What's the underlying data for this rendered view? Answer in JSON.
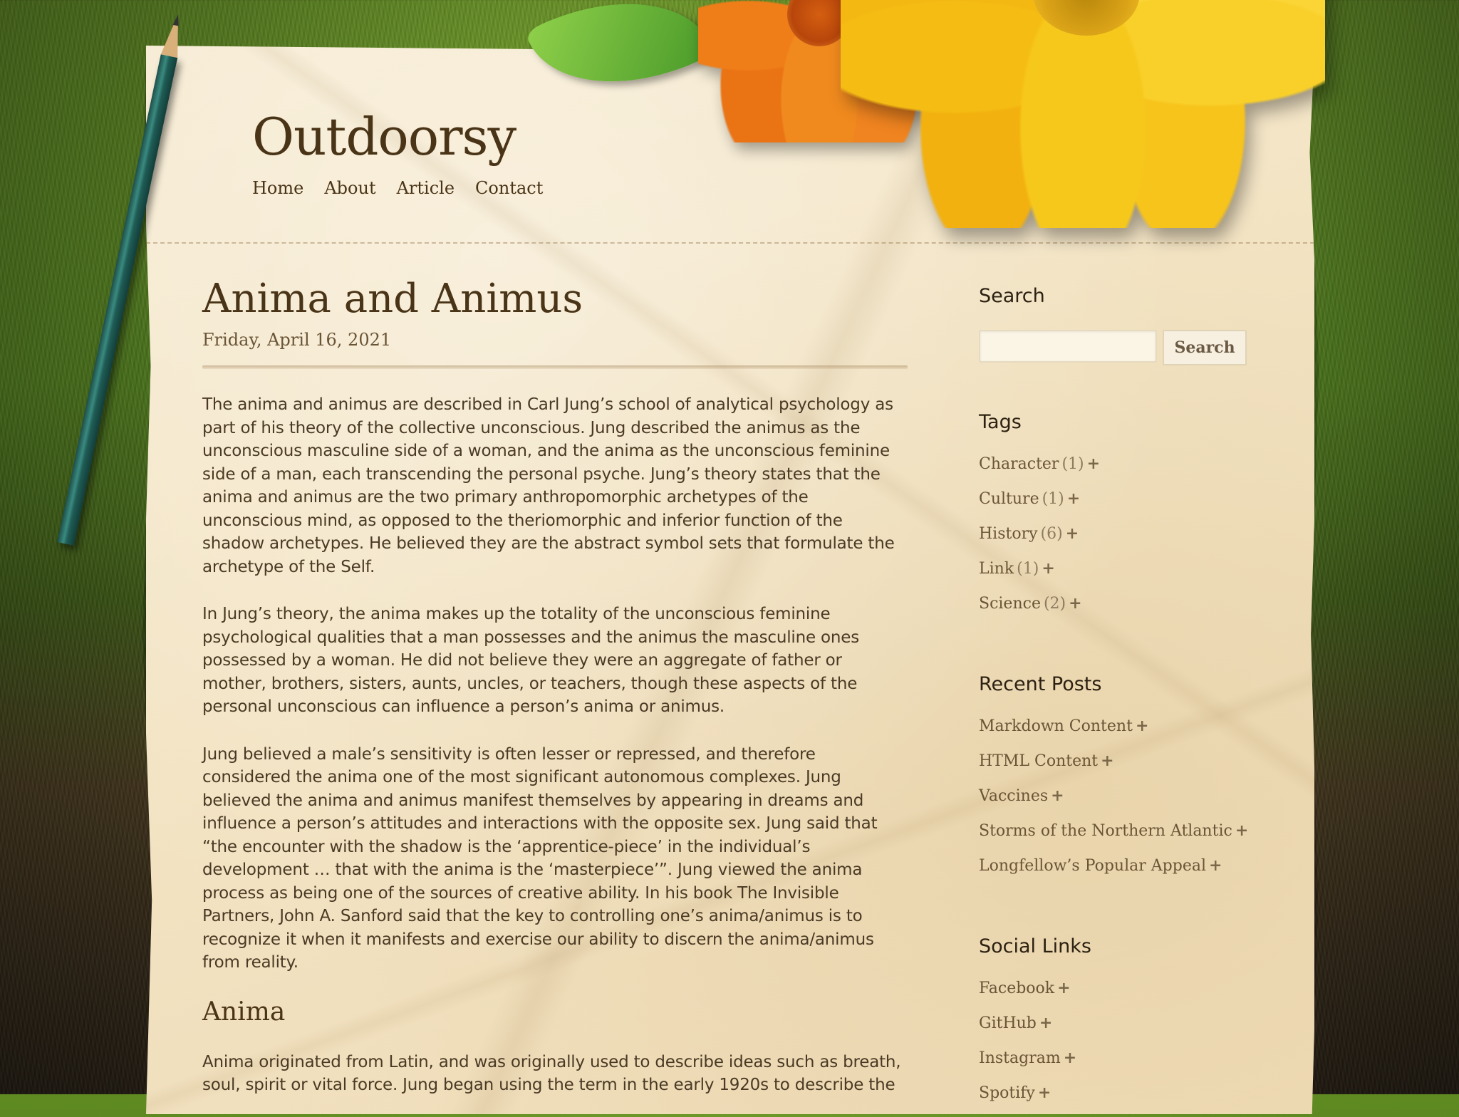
{
  "site": {
    "title": "Outdoorsy",
    "nav": [
      "Home",
      "About",
      "Article",
      "Contact"
    ]
  },
  "post": {
    "title": "Anima and Animus",
    "date": "Friday, April 16, 2021",
    "paragraphs": [
      "The anima and animus are described in Carl Jung’s school of analytical psychology as part of his theory of the collective unconscious. Jung described the animus as the unconscious masculine side of a woman, and the anima as the unconscious feminine side of a man, each transcending the personal psyche. Jung’s theory states that the anima and animus are the two primary anthropomorphic archetypes of the unconscious mind, as opposed to the theriomorphic and inferior function of the shadow archetypes. He believed they are the abstract symbol sets that formulate the archetype of the Self.",
      "In Jung’s theory, the anima makes up the totality of the unconscious feminine psychological qualities that a man possesses and the animus the masculine ones possessed by a woman. He did not believe they were an aggregate of father or mother, brothers, sisters, aunts, uncles, or teachers, though these aspects of the personal unconscious can influence a person’s anima or animus.",
      "Jung believed a male’s sensitivity is often lesser or repressed, and therefore considered the anima one of the most significant autonomous complexes. Jung believed the anima and animus manifest themselves by appearing in dreams and influence a person’s attitudes and interactions with the opposite sex. Jung said that “the encounter with the shadow is the ‘apprentice-piece’ in the individual’s development … that with the anima is the ‘masterpiece’”. Jung viewed the anima process as being one of the sources of creative ability. In his book The Invisible Partners, John A. Sanford said that the key to controlling one’s anima/animus is to recognize it when it manifests and exercise our ability to discern the anima/animus from reality."
    ],
    "subheading": "Anima",
    "subparagraph": "Anima originated from Latin, and was originally used to describe ideas such as breath, soul, spirit or vital force. Jung began using the term in the early 1920s to describe the"
  },
  "sidebar": {
    "search": {
      "title": "Search",
      "placeholder": "",
      "button": "Search"
    },
    "tags": {
      "title": "Tags",
      "items": [
        {
          "label": "Character",
          "count": "(1)"
        },
        {
          "label": "Culture",
          "count": "(1)"
        },
        {
          "label": "History",
          "count": "(6)"
        },
        {
          "label": "Link",
          "count": "(1)"
        },
        {
          "label": "Science",
          "count": "(2)"
        }
      ]
    },
    "recent": {
      "title": "Recent Posts",
      "items": [
        "Markdown Content",
        "HTML Content",
        "Vaccines",
        "Storms of the Northern Atlantic",
        "Longfellow’s Popular Appeal"
      ]
    },
    "social": {
      "title": "Social Links",
      "items": [
        "Facebook",
        "GitHub",
        "Instagram",
        "Spotify"
      ]
    },
    "plus_symbol": "+"
  },
  "colors": {
    "text_dark": "#4a3417",
    "text_body": "#4a3a25",
    "paper": "#f3e4c4",
    "grass": "#4e7a1c"
  }
}
